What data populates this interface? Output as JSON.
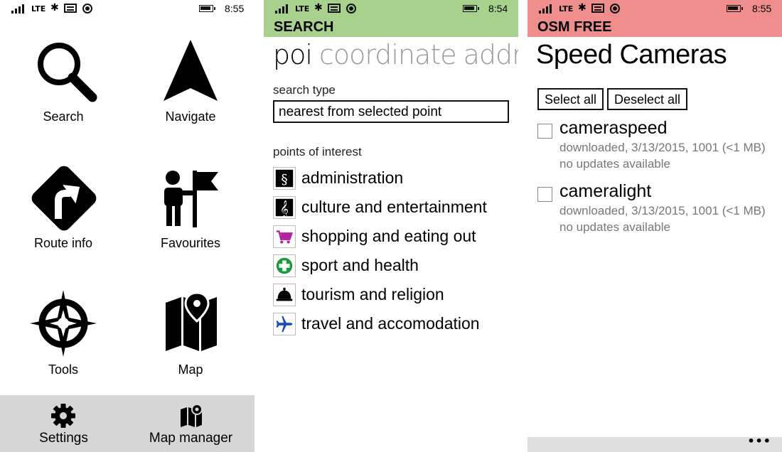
{
  "status": {
    "network": "LTE",
    "p1_time": "8:55",
    "p2_time": "8:54",
    "p3_time": "8:55"
  },
  "menu": {
    "tiles": [
      {
        "label": "Search",
        "icon": "search-icon"
      },
      {
        "label": "Navigate",
        "icon": "navigate-arrow-icon"
      },
      {
        "label": "Route info",
        "icon": "route-sign-icon"
      },
      {
        "label": "Favourites",
        "icon": "person-flag-icon"
      },
      {
        "label": "Tools",
        "icon": "compass-rose-icon"
      },
      {
        "label": "Map",
        "icon": "map-pin-icon"
      }
    ],
    "bottom": [
      {
        "label": "Settings",
        "icon": "gear-icon"
      },
      {
        "label": "Map manager",
        "icon": "map-gear-icon"
      }
    ],
    "bottom_bar_color": "#d6d6d6"
  },
  "search": {
    "header": "SEARCH",
    "header_color": "#a9d18e",
    "pivots": [
      "poi",
      "coordinate",
      "address"
    ],
    "search_type_label": "search type",
    "search_type_value": "nearest from selected point",
    "poi_label": "points of interest",
    "categories": [
      {
        "label": "administration",
        "icon": "section-sign-icon"
      },
      {
        "label": "culture and entertainment",
        "icon": "treble-clef-icon"
      },
      {
        "label": "shopping and eating out",
        "icon": "shopping-cart-icon"
      },
      {
        "label": "sport and health",
        "icon": "medical-cross-icon"
      },
      {
        "label": "tourism and religion",
        "icon": "bell-icon"
      },
      {
        "label": "travel and accomodation",
        "icon": "airplane-icon"
      }
    ]
  },
  "cameras": {
    "header": "OSM FREE",
    "header_color": "#f08d8d",
    "title": "Speed Cameras",
    "select_all": "Select all",
    "deselect_all": "Deselect all",
    "items": [
      {
        "name": "cameraspeed",
        "detail": "downloaded, 3/13/2015, 1001 (<1 MB)",
        "status": "no updates available"
      },
      {
        "name": "cameralight",
        "detail": "downloaded, 3/13/2015, 1001 (<1 MB)",
        "status": "no updates available"
      }
    ],
    "more": "•••"
  }
}
